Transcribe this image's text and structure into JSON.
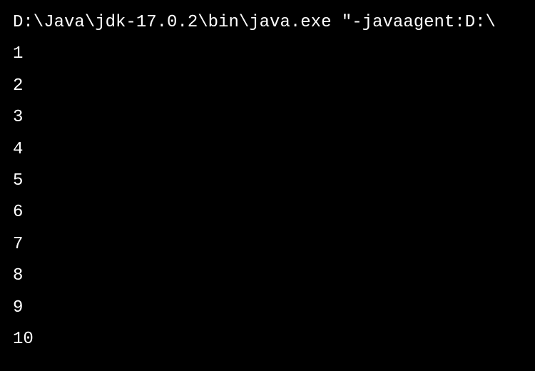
{
  "console": {
    "command": "D:\\Java\\jdk-17.0.2\\bin\\java.exe \"-javaagent:D:\\",
    "output": [
      "1",
      "2",
      "3",
      "4",
      "5",
      "6",
      "7",
      "8",
      "9",
      "10"
    ]
  }
}
